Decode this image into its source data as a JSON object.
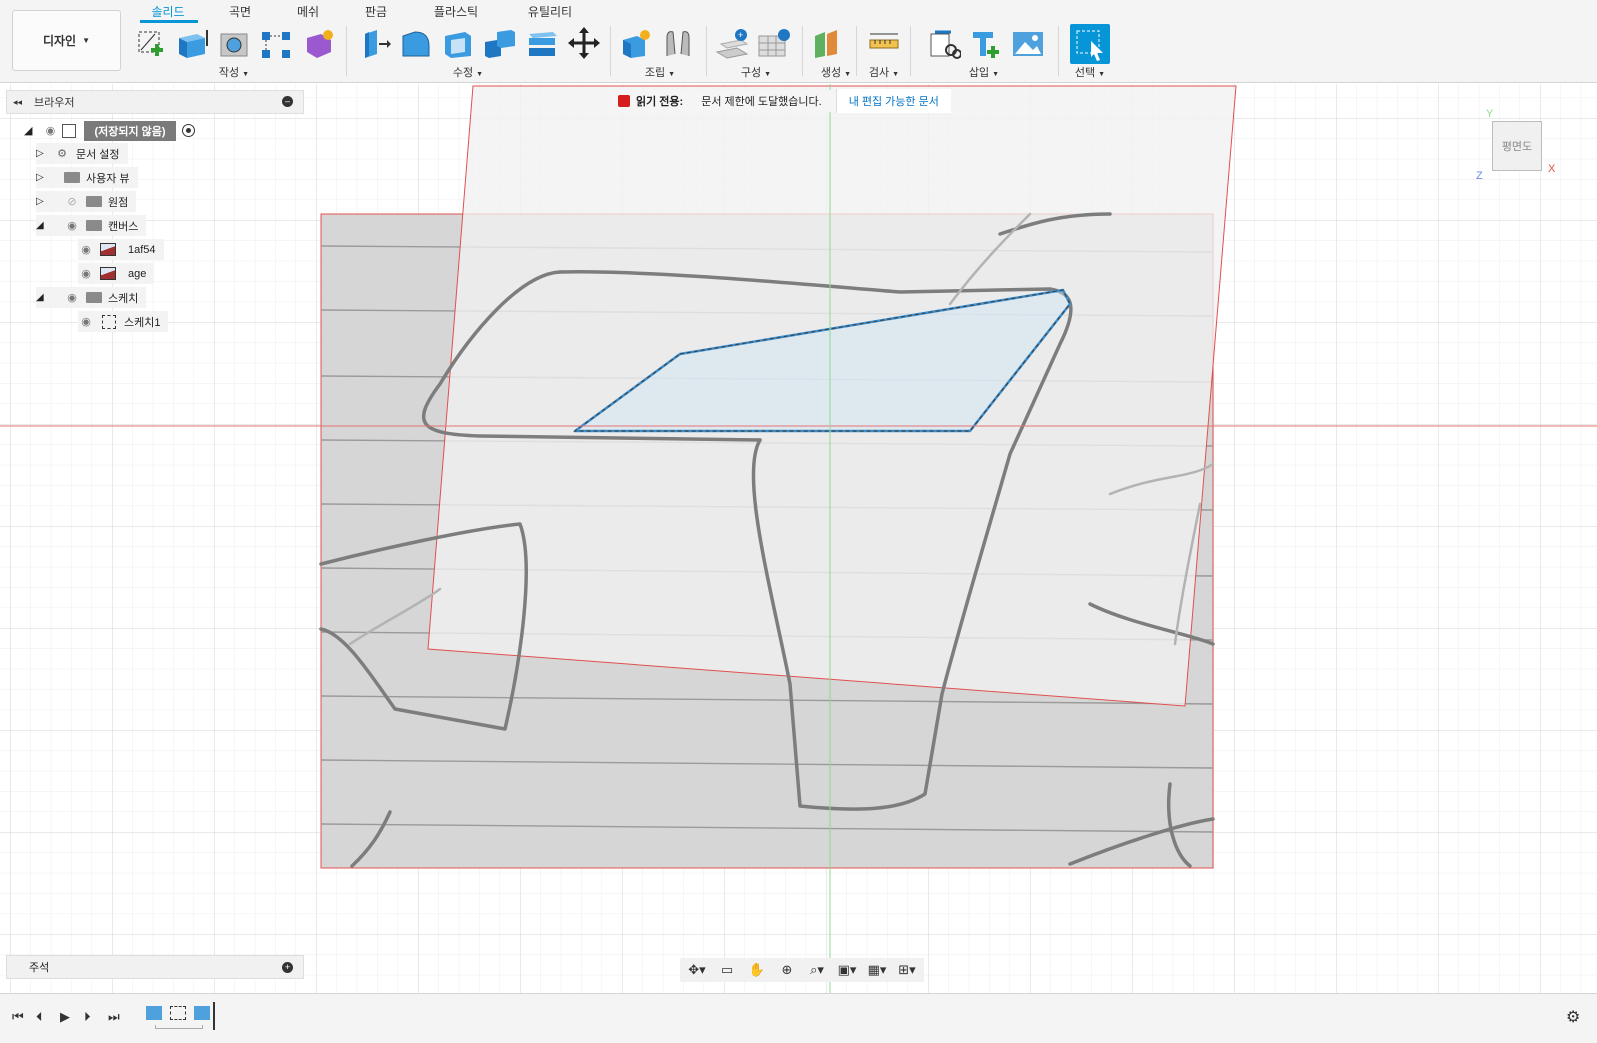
{
  "workspace": {
    "label": "디자인"
  },
  "tabs": [
    "솔리드",
    "곡면",
    "메쉬",
    "판금",
    "플라스틱",
    "유틸리티"
  ],
  "active_tab": "솔리드",
  "groups": {
    "create": "작성",
    "modify": "수정",
    "assemble": "조립",
    "construct": "구성",
    "generate": "생성",
    "inspect": "검사",
    "insert": "삽입",
    "select": "선택"
  },
  "browser": {
    "title": "브라우저",
    "root": "(저장되지 않음)",
    "items": [
      {
        "label": "문서 설정"
      },
      {
        "label": "사용자 뷰"
      },
      {
        "label": "원점"
      },
      {
        "label": "캔버스"
      },
      {
        "label": "1af54"
      },
      {
        "label": "age"
      },
      {
        "label": "스케치"
      },
      {
        "label": "스케치1"
      }
    ]
  },
  "banner": {
    "title": "읽기 전용:",
    "message": "문서 제한에 도달했습니다.",
    "link": "내 편집 가능한 문서"
  },
  "viewcube": {
    "face": "평면도",
    "axis_x": "X",
    "axis_y": "Y",
    "axis_z": "Z"
  },
  "notes": {
    "label": "주석"
  },
  "colors": {
    "accent": "#0696d7",
    "lock": "#d61e1e",
    "boundary": "#e05050",
    "sketch": "#3a8fd0"
  }
}
